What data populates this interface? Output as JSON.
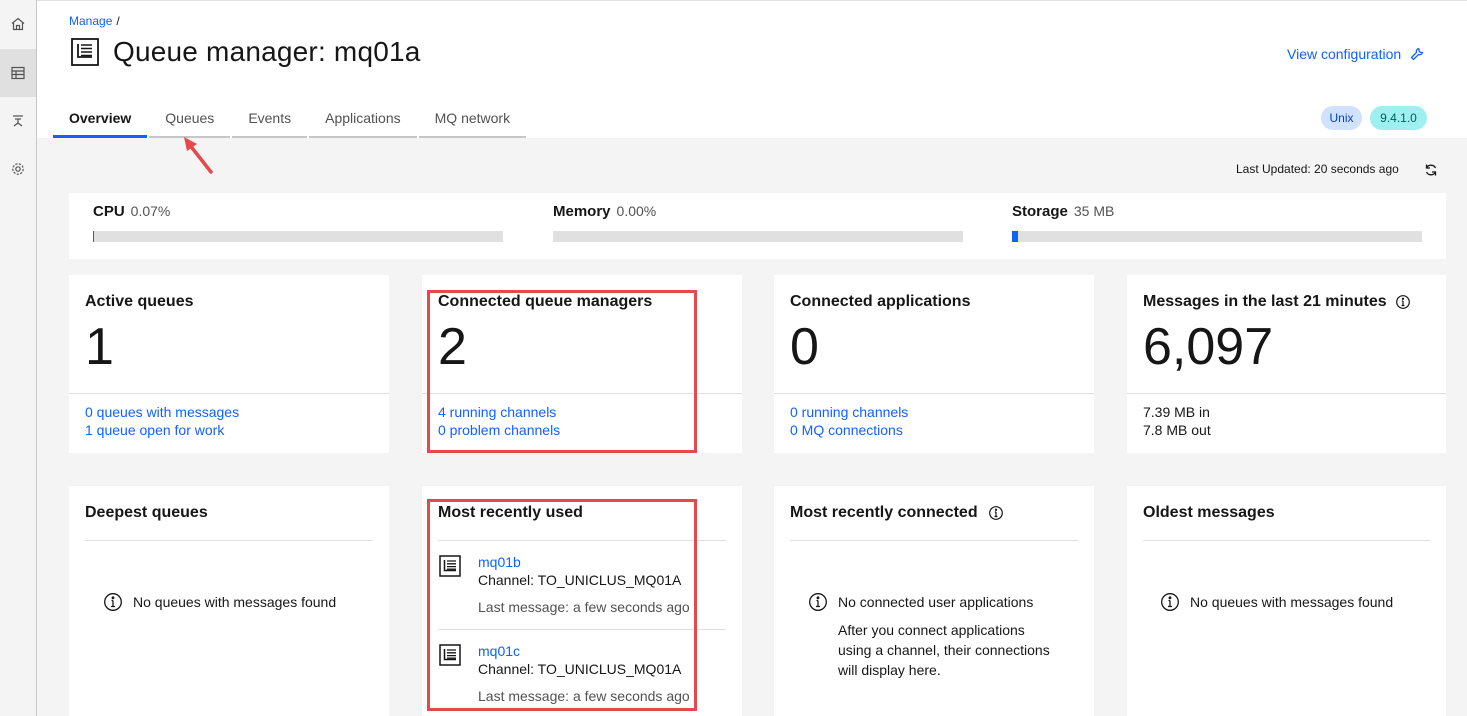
{
  "breadcrumb": {
    "root": "Manage",
    "separator": "/"
  },
  "page": {
    "title": "Queue manager: mq01a",
    "view_config": "View configuration"
  },
  "tabs": [
    "Overview",
    "Queues",
    "Events",
    "Applications",
    "MQ network"
  ],
  "tags": {
    "platform": "Unix",
    "version": "9.4.1.0"
  },
  "last_updated": "Last Updated: 20 seconds ago",
  "usage": {
    "cpu": {
      "label": "CPU",
      "value": "0.07%",
      "fraction": 0.0007
    },
    "memory": {
      "label": "Memory",
      "value": "0.00%",
      "fraction": 0.0
    },
    "storage": {
      "label": "Storage",
      "value": "35 MB",
      "fraction": 0.015
    }
  },
  "cards": {
    "active_queues": {
      "title": "Active queues",
      "value": "1",
      "link1": "0 queues with messages",
      "link2": "1 queue open for work"
    },
    "connected_qm": {
      "title": "Connected queue managers",
      "value": "2",
      "link1": "4 running channels",
      "link2": "0 problem channels"
    },
    "connected_apps": {
      "title": "Connected applications",
      "value": "0",
      "link1": "0 running channels",
      "link2": "0 MQ connections"
    },
    "messages": {
      "title": "Messages in the last 21 minutes",
      "value": "6,097",
      "line1": "7.39 MB in",
      "line2": "7.8 MB out"
    }
  },
  "deepest": {
    "title": "Deepest queues",
    "empty": "No queues with messages found"
  },
  "recent_used": {
    "title": "Most recently used",
    "items": [
      {
        "name": "mq01b",
        "channel": "Channel: TO_UNICLUS_MQ01A",
        "last": "Last message: a few seconds ago"
      },
      {
        "name": "mq01c",
        "channel": "Channel: TO_UNICLUS_MQ01A",
        "last": "Last message: a few seconds ago"
      }
    ]
  },
  "recent_connected": {
    "title": "Most recently connected",
    "empty": "No connected user applications",
    "sub1": "After you connect applications",
    "sub2": "using a channel, their connections",
    "sub3": "will display here."
  },
  "oldest": {
    "title": "Oldest messages",
    "empty": "No queues with messages found"
  },
  "colors": {
    "accent": "#0f62fe",
    "highlight": "#e5484d"
  }
}
